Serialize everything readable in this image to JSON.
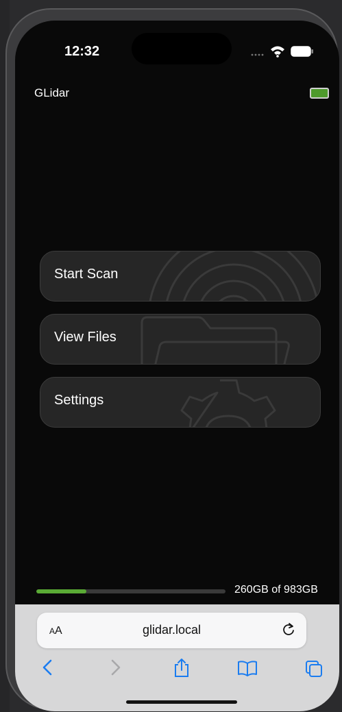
{
  "status_bar": {
    "time": "12:32"
  },
  "header": {
    "title": "GLidar"
  },
  "menu": {
    "items": [
      {
        "label": "Start Scan",
        "icon": "radar-icon"
      },
      {
        "label": "View Files",
        "icon": "folder-icon"
      },
      {
        "label": "Settings",
        "icon": "gear-icon"
      }
    ]
  },
  "storage": {
    "text": "260GB of 983GB",
    "used_fraction": 0.264,
    "bar_color": "#5aaa35"
  },
  "browser": {
    "aa_label_big": "A",
    "aa_label_small": "A",
    "url": "glidar.local",
    "toolbar": [
      "back-icon",
      "forward-icon",
      "share-icon",
      "bookmarks-icon",
      "tabs-icon"
    ]
  },
  "colors": {
    "accent_blue": "#1a7cf0",
    "battery_green": "#4e9a2c"
  }
}
